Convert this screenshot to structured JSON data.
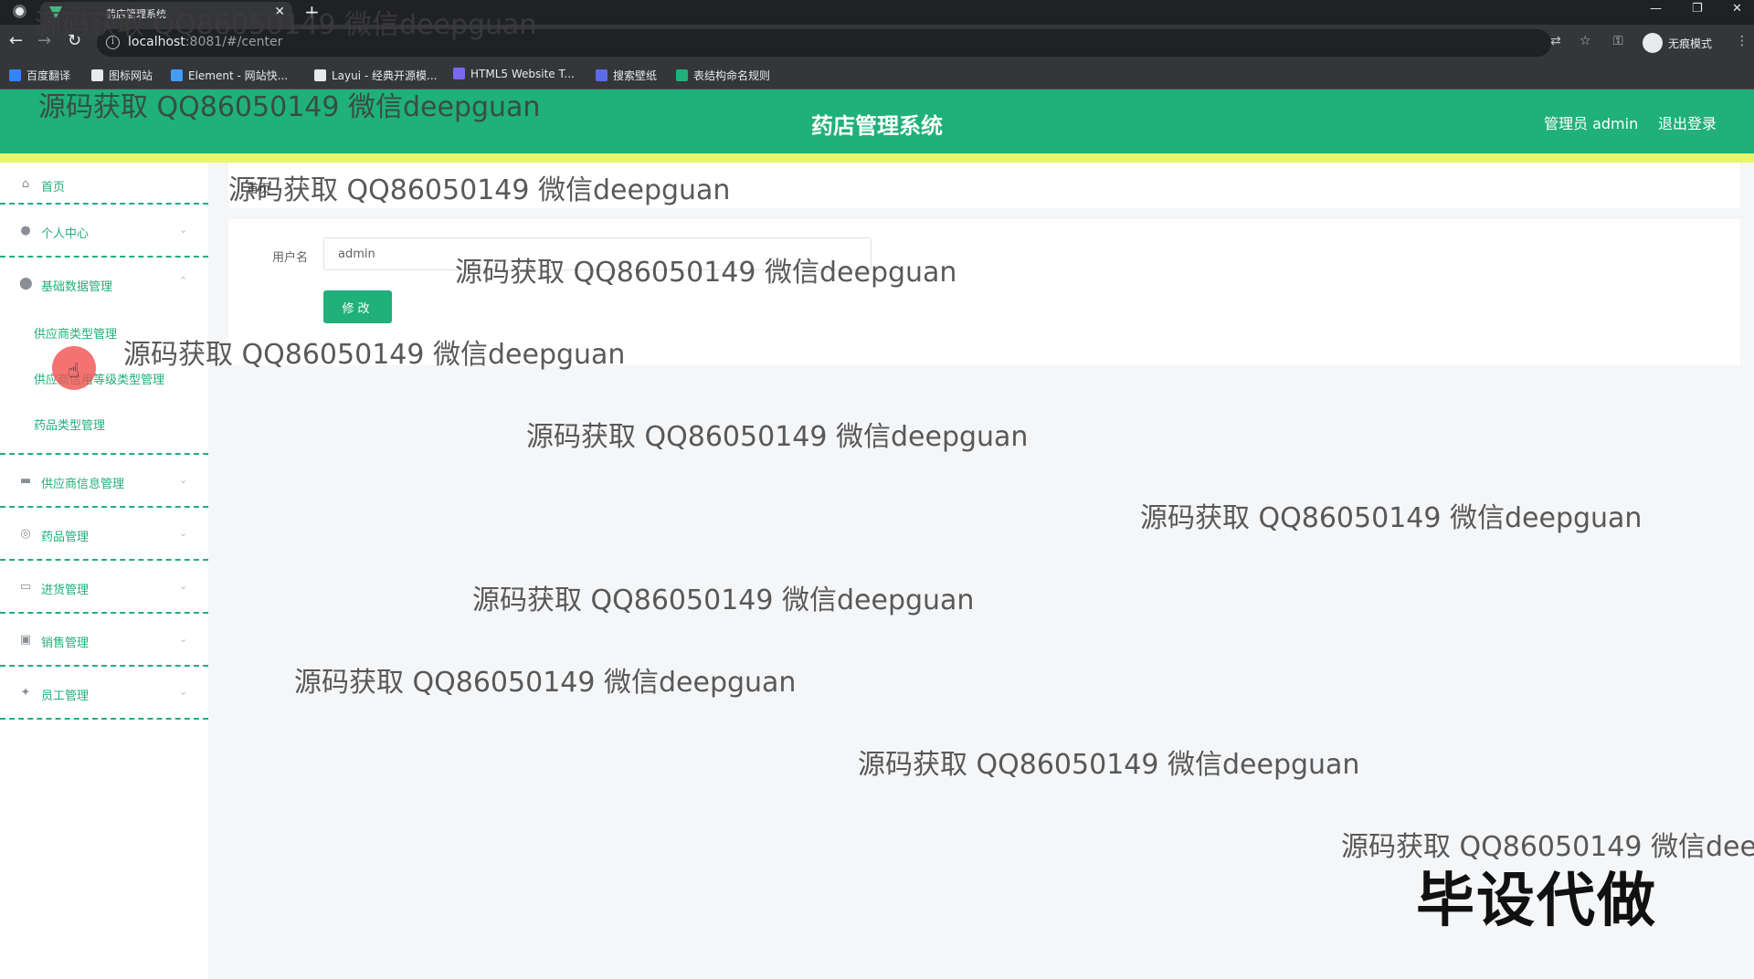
{
  "browser": {
    "tab_title": "药店管理系统",
    "url_host": "localhost",
    "url_path": ":8081/#/center",
    "incognito_label": "无痕模式",
    "bookmarks": [
      {
        "label": "百度翻译",
        "color": "#3385ff"
      },
      {
        "label": "图标网站",
        "color": "#e8eaed"
      },
      {
        "label": "Element - 网站快...",
        "color": "#409eff"
      },
      {
        "label": "Layui - 经典开源模...",
        "color": "#e8eaed"
      },
      {
        "label": "HTML5 Website T...",
        "color": "#7b68ee"
      },
      {
        "label": "搜索壁纸",
        "color": "#5b6be8"
      },
      {
        "label": "表结构命名规则",
        "color": "#20b07a"
      }
    ]
  },
  "header": {
    "title": "药店管理系统",
    "admin": "管理员 admin",
    "logout": "退出登录",
    "color": "#20b07a"
  },
  "sidebar": {
    "home": "首页",
    "personal": "个人中心",
    "basic": "基础数据管理",
    "sub_items": [
      "供应商类型管理",
      "供应商信用等级类型管理",
      "药品类型管理"
    ],
    "supplier": "供应商信息管理",
    "drug": "药品管理",
    "purchase": "进货管理",
    "sales": "销售管理",
    "staff": "员工管理"
  },
  "main": {
    "breadcrumb": "首页",
    "username_label": "用户名",
    "username_value": "admin",
    "submit_label": "修改"
  },
  "watermarks": {
    "text": "源码获取 QQ86050149 微信deepguan",
    "big": "毕设代做"
  }
}
